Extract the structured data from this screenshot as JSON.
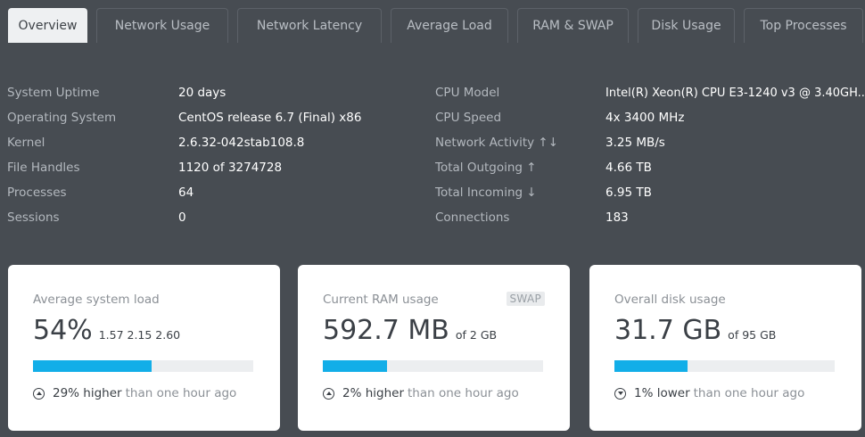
{
  "tabs": [
    {
      "label": "Overview",
      "active": true
    },
    {
      "label": "Network Usage"
    },
    {
      "label": "Network Latency"
    },
    {
      "label": "Average Load"
    },
    {
      "label": "RAM & SWAP"
    },
    {
      "label": "Disk Usage"
    },
    {
      "label": "Top Processes"
    }
  ],
  "system_info": [
    {
      "label": "System Uptime",
      "value": "20 days"
    },
    {
      "label": "Operating System",
      "value": "CentOS release 6.7 (Final) x86"
    },
    {
      "label": "Kernel",
      "value": "2.6.32-042stab108.8"
    },
    {
      "label": "File Handles",
      "value": "1120 of 3274728"
    },
    {
      "label": "Processes",
      "value": "64"
    },
    {
      "label": "Sessions",
      "value": "0"
    }
  ],
  "hardware_info": [
    {
      "label": "CPU Model",
      "value": "Intel(R) Xeon(R) CPU E3-1240 v3 @ 3.40GH..."
    },
    {
      "label": "CPU Speed",
      "value": "4x 3400 MHz"
    },
    {
      "label": "Network Activity ↑↓",
      "value": "3.25 MB/s"
    },
    {
      "label": "Total Outgoing ↑",
      "value": "4.66 TB"
    },
    {
      "label": "Total Incoming ↓",
      "value": "6.95 TB"
    },
    {
      "label": "Connections",
      "value": "183"
    }
  ],
  "cards": {
    "load": {
      "title": "Average system load",
      "value": "54%",
      "sub": "1.57 2.15 2.60",
      "progress": 0.54,
      "trend_direction": "up",
      "trend_strong": "29% higher",
      "trend_rest": "than one hour ago"
    },
    "ram": {
      "title": "Current RAM usage",
      "badge": "SWAP",
      "value": "592.7 MB",
      "sub": "of 2 GB",
      "progress": 0.29,
      "trend_direction": "up",
      "trend_strong": "2% higher",
      "trend_rest": "than one hour ago"
    },
    "disk": {
      "title": "Overall disk usage",
      "value": "31.7 GB",
      "sub": "of 95 GB",
      "progress": 0.33,
      "trend_direction": "down",
      "trend_strong": "1% lower",
      "trend_rest": "than one hour ago"
    }
  },
  "colors": {
    "background": "#474c52",
    "card": "#ffffff",
    "accent": "#12aee8",
    "active_tab": "#eef0f2"
  }
}
